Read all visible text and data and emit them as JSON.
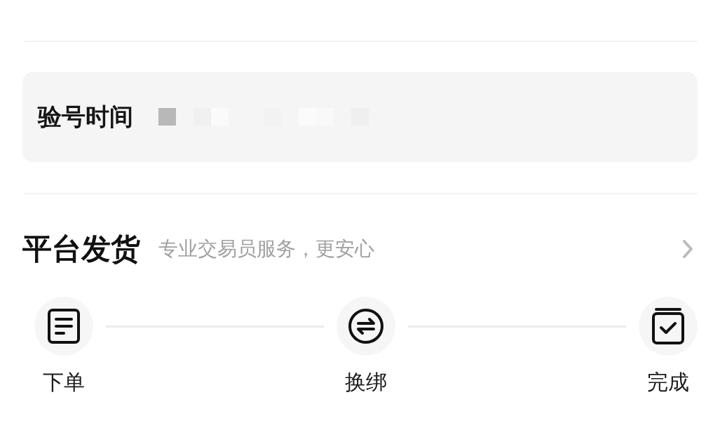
{
  "info_card": {
    "label": "验号时间"
  },
  "section": {
    "title": "平台发货",
    "subtitle": "专业交易员服务，更安心"
  },
  "steps": [
    {
      "label": "下单",
      "kind": "doc"
    },
    {
      "label": "换绑",
      "kind": "swap"
    },
    {
      "label": "完成",
      "kind": "box"
    }
  ]
}
